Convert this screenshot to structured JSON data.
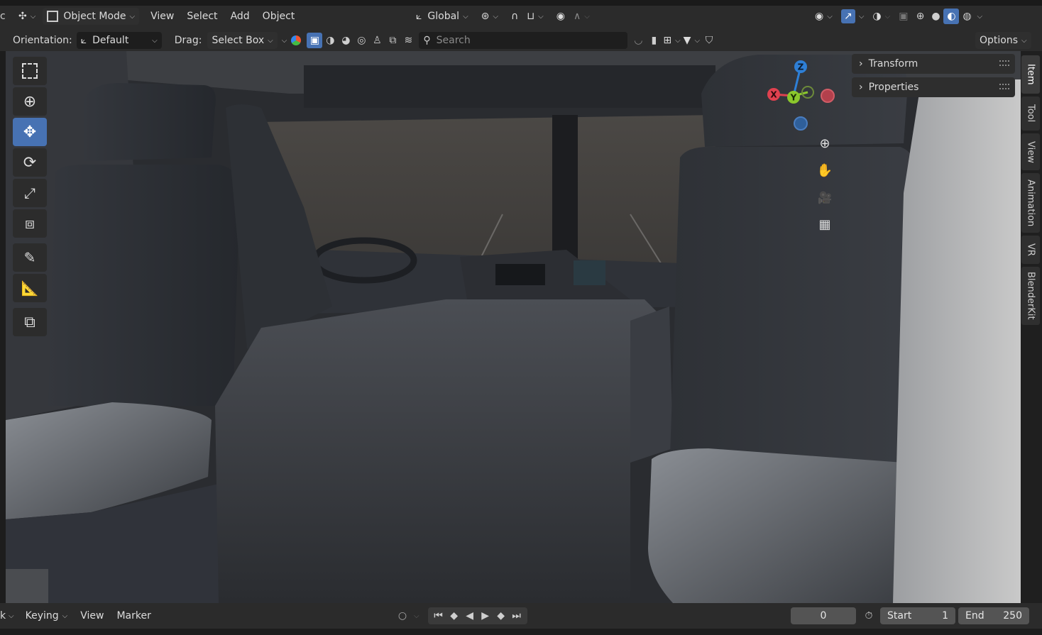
{
  "header": {
    "mode_label": "Object Mode",
    "menus": [
      "View",
      "Select",
      "Add",
      "Object"
    ],
    "transform_orientation": "Global",
    "left_clip": "c"
  },
  "tool_header": {
    "orientation_label": "Orientation:",
    "orientation_value": "Default",
    "drag_label": "Drag:",
    "drag_value": "Select Box",
    "search_placeholder": "Search",
    "options_label": "Options"
  },
  "toolbar": {
    "tools": [
      "select-box",
      "cursor",
      "move",
      "rotate",
      "scale",
      "transform",
      "annotate",
      "measure",
      "add-cube"
    ],
    "active_tool": "move"
  },
  "gizmo": {
    "x": "X",
    "y": "Y",
    "z": "Z"
  },
  "npanel": {
    "panels": [
      "Transform",
      "Properties"
    ],
    "tabs": [
      "Item",
      "Tool",
      "View",
      "Animation",
      "VR",
      "BlenderKit"
    ],
    "active_tab": "Item"
  },
  "timeline": {
    "left_clip": "k",
    "keying_label": "Keying",
    "view_label": "View",
    "marker_label": "Marker",
    "current_frame": "0",
    "start_label": "Start",
    "start_value": "1",
    "end_label": "End",
    "end_value": "250"
  },
  "colors": {
    "accent": "#4772b3",
    "axis_x": "#e0414f",
    "axis_y": "#8bc72c",
    "axis_z": "#2e7fd6"
  }
}
